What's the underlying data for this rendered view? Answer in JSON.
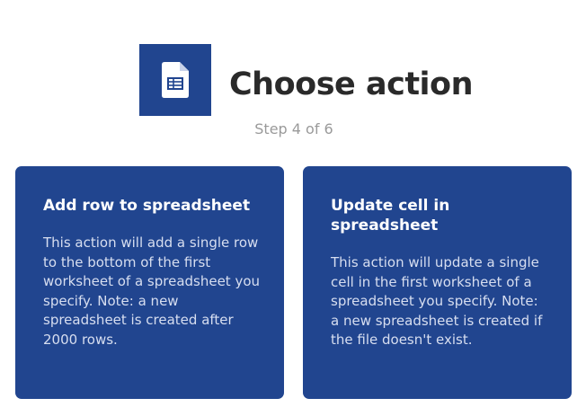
{
  "header": {
    "title": "Choose action",
    "step": "Step 4 of 6",
    "service_icon": "spreadsheet-icon"
  },
  "actions": [
    {
      "title": "Add row to spreadsheet",
      "description": "This action will add a single row to the bottom of the first worksheet of a spreadsheet you specify. Note: a new spreadsheet is created after 2000 rows."
    },
    {
      "title": "Update cell in spreadsheet",
      "description": "This action will update a single cell in the first worksheet of a spreadsheet you specify. Note: a new spreadsheet is created if the file doesn't exist."
    }
  ],
  "colors": {
    "brand": "#21458f",
    "title_text": "#2a2a2a",
    "step_text": "#9a9a9a",
    "card_text": "#ffffff"
  }
}
